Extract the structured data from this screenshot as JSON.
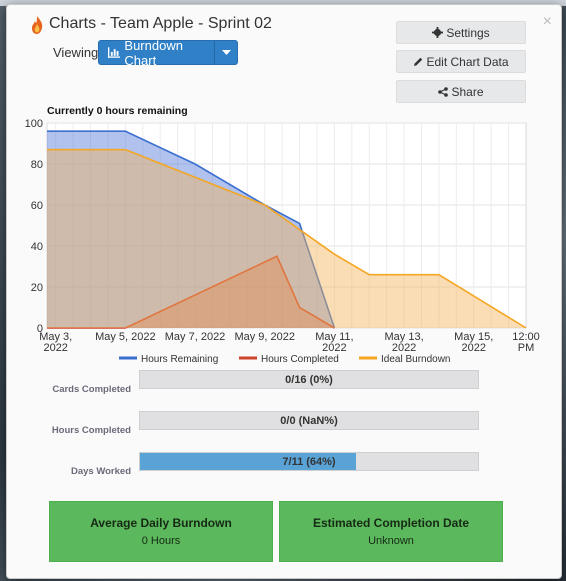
{
  "header": {
    "title": "Charts - Team Apple - Sprint 02",
    "close_glyph": "×"
  },
  "viewing": {
    "label": "Viewing",
    "selected": "Burndown Chart"
  },
  "side_buttons": {
    "settings": "Settings",
    "edit": "Edit Chart Data",
    "share": "Share"
  },
  "chart_data": {
    "type": "area",
    "title": "Currently 0 hours remaining",
    "x_ticks": [
      [
        "May 3,",
        "2022"
      ],
      [
        "May 5, 2022"
      ],
      [
        "May 7, 2022"
      ],
      [
        "May 9, 2022"
      ],
      [
        "May 11,",
        "2022"
      ],
      [
        "May 13,",
        "2022"
      ],
      [
        "May 15,",
        "2022"
      ],
      [
        "12:00",
        "PM"
      ]
    ],
    "x_tick_days": [
      3,
      5,
      7,
      9,
      11,
      13,
      15,
      16.5
    ],
    "ylim": [
      0,
      100
    ],
    "y_ticks": [
      0,
      20,
      40,
      60,
      80,
      100
    ],
    "grid": true,
    "legend_position": "bottom",
    "series": [
      {
        "name": "Hours Remaining",
        "color": "#3a6fd0",
        "fill": "rgba(80,120,215,0.45)",
        "points": [
          [
            2.75,
            96
          ],
          [
            5,
            96
          ],
          [
            7,
            80
          ],
          [
            9,
            60
          ],
          [
            10,
            51
          ],
          [
            11,
            0
          ]
        ]
      },
      {
        "name": "Hours Completed",
        "color": "#d0442a",
        "fill": "rgba(210,110,80,0.45)",
        "points": [
          [
            2.75,
            0
          ],
          [
            5,
            0
          ],
          [
            9.35,
            35
          ],
          [
            10,
            10
          ],
          [
            11,
            0
          ]
        ]
      },
      {
        "name": "Ideal Burndown",
        "color": "#f5a623",
        "fill": "rgba(245,180,90,0.45)",
        "points": [
          [
            2.75,
            87
          ],
          [
            5,
            87
          ],
          [
            9,
            60
          ],
          [
            11,
            36
          ],
          [
            12,
            26
          ],
          [
            14,
            26
          ],
          [
            16.5,
            0
          ]
        ]
      }
    ]
  },
  "stats": {
    "cards": {
      "label": "Cards Completed",
      "text": "0/16 (0%)",
      "fraction": 0
    },
    "hours": {
      "label": "Hours Completed",
      "text": "0/0 (NaN%)",
      "fraction": 0
    },
    "days": {
      "label": "Days Worked",
      "text": "7/11 (64%)",
      "fraction": 0.64
    }
  },
  "boxes": {
    "burndown": {
      "title": "Average Daily Burndown",
      "value": "0 Hours"
    },
    "completion": {
      "title": "Estimated Completion Date",
      "value": "Unknown"
    }
  }
}
